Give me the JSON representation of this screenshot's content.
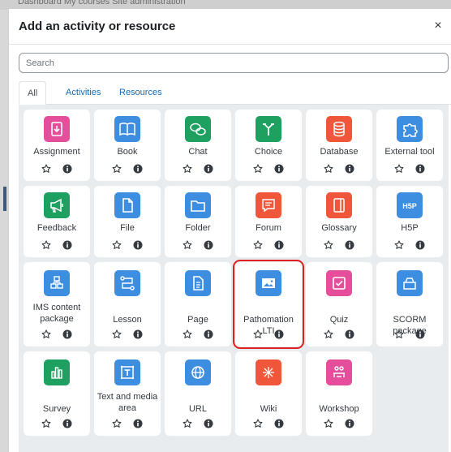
{
  "backdrop": {
    "text": "Dashboard   My courses   Site administration"
  },
  "modal": {
    "title": "Add an activity or resource",
    "close_label": "×",
    "search_placeholder": "Search",
    "tabs": [
      "All",
      "Activities",
      "Resources"
    ],
    "active_tab": "All"
  },
  "items": [
    {
      "label": "Assignment",
      "icon": "assignment-icon",
      "color": "#e54e9a"
    },
    {
      "label": "Book",
      "icon": "book-icon",
      "color": "#3d8ee0"
    },
    {
      "label": "Chat",
      "icon": "chat-icon",
      "color": "#1ea060"
    },
    {
      "label": "Choice",
      "icon": "choice-icon",
      "color": "#1ea060"
    },
    {
      "label": "Database",
      "icon": "database-icon",
      "color": "#f0563a"
    },
    {
      "label": "External tool",
      "icon": "puzzle-icon",
      "color": "#3d8ee0"
    },
    {
      "label": "Feedback",
      "icon": "megaphone-icon",
      "color": "#1ea060"
    },
    {
      "label": "File",
      "icon": "file-icon",
      "color": "#3d8ee0"
    },
    {
      "label": "Folder",
      "icon": "folder-icon",
      "color": "#3d8ee0"
    },
    {
      "label": "Forum",
      "icon": "forum-icon",
      "color": "#f0563a"
    },
    {
      "label": "Glossary",
      "icon": "glossary-icon",
      "color": "#f0563a"
    },
    {
      "label": "H5P",
      "icon": "h5p-icon",
      "color": "#3d8ee0"
    },
    {
      "label": "IMS content package",
      "icon": "package-icon",
      "color": "#3d8ee0"
    },
    {
      "label": "Lesson",
      "icon": "lesson-icon",
      "color": "#3d8ee0"
    },
    {
      "label": "Page",
      "icon": "page-icon",
      "color": "#3d8ee0"
    },
    {
      "label": "Pathomation LTI",
      "icon": "image-icon",
      "color": "#3d8ee0",
      "highlighted": true
    },
    {
      "label": "Quiz",
      "icon": "quiz-icon",
      "color": "#e54e9a"
    },
    {
      "label": "SCORM package",
      "icon": "scorm-icon",
      "color": "#3d8ee0"
    },
    {
      "label": "Survey",
      "icon": "survey-icon",
      "color": "#1ea060"
    },
    {
      "label": "Text and media area",
      "icon": "text-media-icon",
      "color": "#3d8ee0"
    },
    {
      "label": "URL",
      "icon": "globe-icon",
      "color": "#3d8ee0"
    },
    {
      "label": "Wiki",
      "icon": "wiki-icon",
      "color": "#f0563a"
    },
    {
      "label": "Workshop",
      "icon": "workshop-icon",
      "color": "#e54e9a"
    }
  ]
}
